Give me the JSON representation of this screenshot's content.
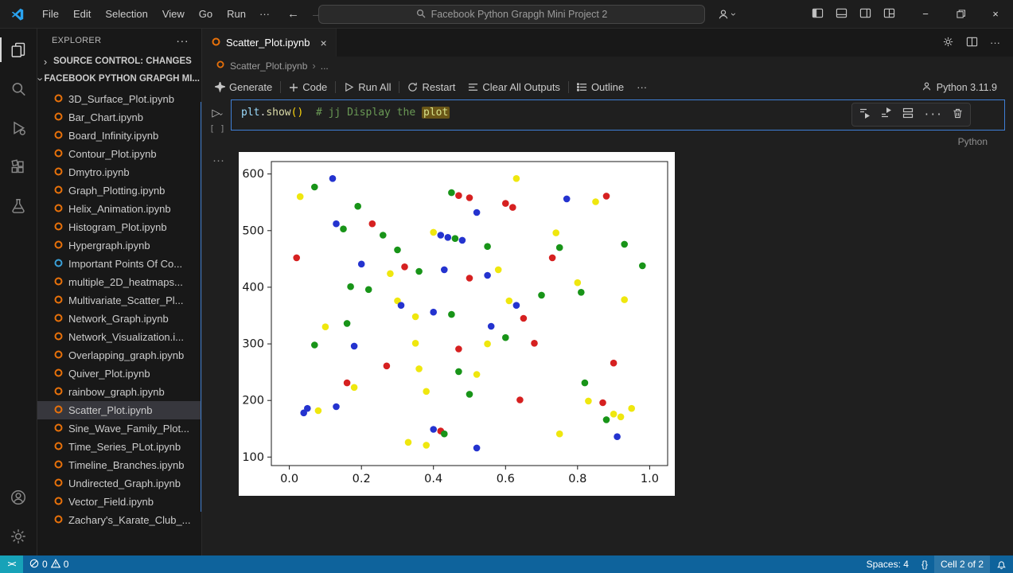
{
  "titlebar": {
    "menus": [
      "File",
      "Edit",
      "Selection",
      "View",
      "Go",
      "Run"
    ],
    "search_text": "Facebook Python Grapgh Mini Project 2"
  },
  "sidebar": {
    "title": "EXPLORER",
    "source_control_section": "SOURCE CONTROL: CHANGES",
    "folder_section": "FACEBOOK PYTHON GRAPGH MI...",
    "files": [
      {
        "name": "3D_Surface_Plot.ipynb",
        "icon": "orange"
      },
      {
        "name": "Bar_Chart.ipynb",
        "icon": "orange"
      },
      {
        "name": "Board_Infinity.ipynb",
        "icon": "orange"
      },
      {
        "name": "Contour_Plot.ipynb",
        "icon": "orange"
      },
      {
        "name": "Dmytro.ipynb",
        "icon": "orange"
      },
      {
        "name": "Graph_Plotting.ipynb",
        "icon": "orange"
      },
      {
        "name": "Helix_Animation.ipynb",
        "icon": "orange"
      },
      {
        "name": "Histogram_Plot.ipynb",
        "icon": "orange"
      },
      {
        "name": "Hypergraph.ipynb",
        "icon": "orange"
      },
      {
        "name": "Important Points Of Co...",
        "icon": "blue"
      },
      {
        "name": "multiple_2D_heatmaps...",
        "icon": "orange"
      },
      {
        "name": "Multivariate_Scatter_Pl...",
        "icon": "orange"
      },
      {
        "name": "Network_Graph.ipynb",
        "icon": "orange"
      },
      {
        "name": "Network_Visualization.i...",
        "icon": "orange"
      },
      {
        "name": "Overlapping_graph.ipynb",
        "icon": "orange"
      },
      {
        "name": "Quiver_Plot.ipynb",
        "icon": "orange"
      },
      {
        "name": "rainbow_graph.ipynb",
        "icon": "orange"
      },
      {
        "name": "Scatter_Plot.ipynb",
        "icon": "orange",
        "selected": true
      },
      {
        "name": "Sine_Wave_Family_Plot...",
        "icon": "orange"
      },
      {
        "name": "Time_Series_PLot.ipynb",
        "icon": "orange"
      },
      {
        "name": "Timeline_Branches.ipynb",
        "icon": "orange"
      },
      {
        "name": "Undirected_Graph.ipynb",
        "icon": "orange"
      },
      {
        "name": "Vector_Field.ipynb",
        "icon": "orange"
      },
      {
        "name": "Zachary's_Karate_Club_...",
        "icon": "orange"
      }
    ]
  },
  "editor": {
    "tab_label": "Scatter_Plot.ipynb",
    "breadcrumb_file": "Scatter_Plot.ipynb",
    "breadcrumb_more": "...",
    "toolbar": {
      "generate": "Generate",
      "code": "Code",
      "run_all": "Run All",
      "restart": "Restart",
      "clear_outputs": "Clear All Outputs",
      "outline": "Outline",
      "kernel": "Python 3.11.9"
    },
    "cell": {
      "obj": "plt",
      "dot": ".",
      "method": "show",
      "parens": "()",
      "comment": "# jj Display the ",
      "highlight_word": "plot",
      "exec_count": "[ ]",
      "lang": "Python"
    }
  },
  "statusbar": {
    "errors": "0",
    "warnings": "0",
    "spaces": "Spaces: 4",
    "braces": "{}",
    "cell_indicator": "Cell 2 of 2"
  },
  "chart_data": {
    "type": "scatter",
    "title": "",
    "xlabel": "",
    "ylabel": "",
    "xlim": [
      -0.05,
      1.05
    ],
    "ylim": [
      85,
      622
    ],
    "xticks": [
      0.0,
      0.2,
      0.4,
      0.6,
      0.8,
      1.0
    ],
    "yticks": [
      100,
      200,
      300,
      400,
      500,
      600
    ],
    "grid": false,
    "legend": "none",
    "colors": {
      "r": "#d62020",
      "g": "#189418",
      "b": "#2433cf",
      "y": "#efe70e"
    },
    "points": [
      [
        0.03,
        560,
        "y"
      ],
      [
        0.07,
        577,
        "g"
      ],
      [
        0.12,
        592,
        "b"
      ],
      [
        0.19,
        543,
        "g"
      ],
      [
        0.13,
        512,
        "b"
      ],
      [
        0.15,
        503,
        "g"
      ],
      [
        0.23,
        512,
        "r"
      ],
      [
        0.26,
        492,
        "g"
      ],
      [
        0.45,
        567,
        "g"
      ],
      [
        0.47,
        562,
        "r"
      ],
      [
        0.5,
        558,
        "r"
      ],
      [
        0.52,
        532,
        "b"
      ],
      [
        0.6,
        548,
        "r"
      ],
      [
        0.62,
        541,
        "r"
      ],
      [
        0.63,
        592,
        "y"
      ],
      [
        0.77,
        556,
        "b"
      ],
      [
        0.85,
        551,
        "y"
      ],
      [
        0.88,
        561,
        "r"
      ],
      [
        0.4,
        497,
        "y"
      ],
      [
        0.42,
        492,
        "b"
      ],
      [
        0.44,
        488,
        "b"
      ],
      [
        0.46,
        486,
        "g"
      ],
      [
        0.48,
        483,
        "b"
      ],
      [
        0.55,
        472,
        "g"
      ],
      [
        0.3,
        466,
        "g"
      ],
      [
        0.02,
        452,
        "r"
      ],
      [
        0.2,
        441,
        "b"
      ],
      [
        0.32,
        436,
        "r"
      ],
      [
        0.36,
        428,
        "g"
      ],
      [
        0.43,
        431,
        "b"
      ],
      [
        0.28,
        424,
        "y"
      ],
      [
        0.5,
        416,
        "r"
      ],
      [
        0.74,
        496,
        "y"
      ],
      [
        0.75,
        470,
        "g"
      ],
      [
        0.73,
        452,
        "r"
      ],
      [
        0.93,
        476,
        "g"
      ],
      [
        0.98,
        438,
        "g"
      ],
      [
        0.8,
        408,
        "y"
      ],
      [
        0.81,
        391,
        "g"
      ],
      [
        0.93,
        378,
        "y"
      ],
      [
        0.17,
        401,
        "g"
      ],
      [
        0.22,
        396,
        "g"
      ],
      [
        0.3,
        376,
        "y"
      ],
      [
        0.31,
        368,
        "b"
      ],
      [
        0.4,
        356,
        "b"
      ],
      [
        0.45,
        352,
        "g"
      ],
      [
        0.35,
        348,
        "y"
      ],
      [
        0.61,
        376,
        "y"
      ],
      [
        0.63,
        368,
        "b"
      ],
      [
        0.7,
        386,
        "g"
      ],
      [
        0.56,
        331,
        "b"
      ],
      [
        0.65,
        345,
        "r"
      ],
      [
        0.6,
        311,
        "g"
      ],
      [
        0.16,
        336,
        "g"
      ],
      [
        0.1,
        330,
        "y"
      ],
      [
        0.07,
        298,
        "g"
      ],
      [
        0.18,
        296,
        "b"
      ],
      [
        0.35,
        301,
        "y"
      ],
      [
        0.47,
        291,
        "r"
      ],
      [
        0.55,
        300,
        "y"
      ],
      [
        0.68,
        301,
        "r"
      ],
      [
        0.27,
        261,
        "r"
      ],
      [
        0.36,
        256,
        "y"
      ],
      [
        0.47,
        251,
        "g"
      ],
      [
        0.52,
        246,
        "y"
      ],
      [
        0.9,
        266,
        "r"
      ],
      [
        0.82,
        231,
        "g"
      ],
      [
        0.16,
        231,
        "r"
      ],
      [
        0.18,
        223,
        "y"
      ],
      [
        0.38,
        216,
        "y"
      ],
      [
        0.5,
        211,
        "g"
      ],
      [
        0.64,
        201,
        "r"
      ],
      [
        0.83,
        199,
        "y"
      ],
      [
        0.87,
        196,
        "r"
      ],
      [
        0.05,
        186,
        "b"
      ],
      [
        0.04,
        178,
        "b"
      ],
      [
        0.08,
        182,
        "y"
      ],
      [
        0.13,
        189,
        "b"
      ],
      [
        0.95,
        186,
        "y"
      ],
      [
        0.9,
        176,
        "y"
      ],
      [
        0.92,
        171,
        "y"
      ],
      [
        0.88,
        166,
        "g"
      ],
      [
        0.4,
        149,
        "b"
      ],
      [
        0.42,
        146,
        "r"
      ],
      [
        0.43,
        141,
        "g"
      ],
      [
        0.33,
        126,
        "y"
      ],
      [
        0.38,
        121,
        "y"
      ],
      [
        0.75,
        141,
        "y"
      ],
      [
        0.91,
        136,
        "b"
      ],
      [
        0.52,
        116,
        "b"
      ],
      [
        0.55,
        421,
        "b"
      ],
      [
        0.58,
        431,
        "y"
      ]
    ]
  }
}
